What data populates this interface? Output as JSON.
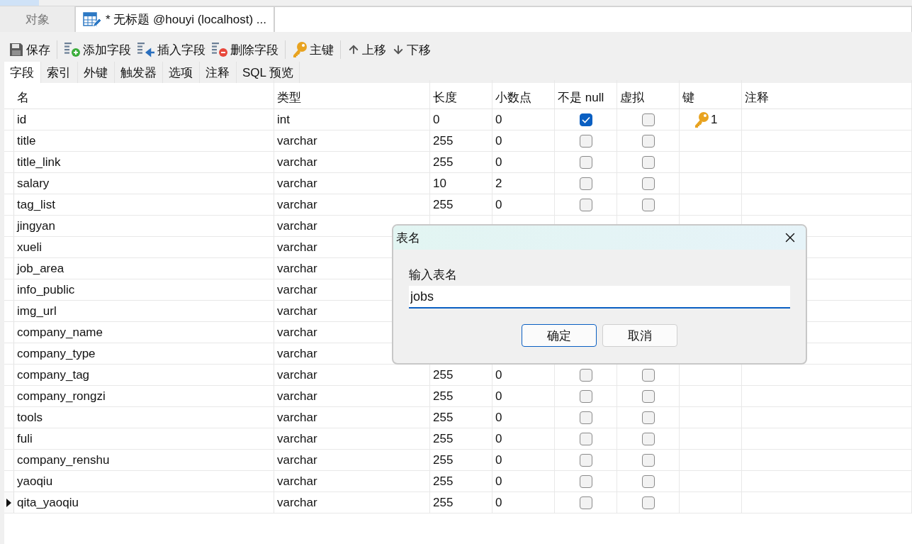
{
  "document_tabs": [
    {
      "label": "对象",
      "selected": false
    },
    {
      "label": "* 无标题 @houyi (localhost) ...",
      "selected": true
    }
  ],
  "toolbar": [
    {
      "kind": "save",
      "label": "保存"
    },
    {
      "kind": "add",
      "label": "添加字段"
    },
    {
      "kind": "insert",
      "label": "插入字段"
    },
    {
      "kind": "delete",
      "label": "删除字段"
    },
    {
      "kind": "key",
      "label": "主键"
    },
    {
      "kind": "up",
      "label": "上移"
    },
    {
      "kind": "down",
      "label": "下移"
    }
  ],
  "designer_tabs": [
    {
      "label": "字段",
      "selected": true
    },
    {
      "label": "索引",
      "selected": false
    },
    {
      "label": "外键",
      "selected": false
    },
    {
      "label": "触发器",
      "selected": false
    },
    {
      "label": "选项",
      "selected": false
    },
    {
      "label": "注释",
      "selected": false
    },
    {
      "label": "SQL 预览",
      "selected": false
    }
  ],
  "table": {
    "columns": [
      "名",
      "类型",
      "长度",
      "小数点",
      "不是 null",
      "虚拟",
      "键",
      "注释"
    ],
    "rows": [
      {
        "name": "id",
        "type": "int",
        "length": "0",
        "decimals": "0",
        "not_null": true,
        "virtual": false,
        "key": "1",
        "selected": false
      },
      {
        "name": "title",
        "type": "varchar",
        "length": "255",
        "decimals": "0",
        "not_null": false,
        "virtual": false,
        "selected": false
      },
      {
        "name": "title_link",
        "type": "varchar",
        "length": "255",
        "decimals": "0",
        "not_null": false,
        "virtual": false,
        "selected": false
      },
      {
        "name": "salary",
        "type": "varchar",
        "length": "10",
        "decimals": "2",
        "not_null": false,
        "virtual": false,
        "selected": false
      },
      {
        "name": "tag_list",
        "type": "varchar",
        "length": "255",
        "decimals": "0",
        "not_null": false,
        "virtual": false,
        "selected": false
      },
      {
        "name": "jingyan",
        "type": "varchar",
        "selected": false
      },
      {
        "name": "xueli",
        "type": "varchar",
        "selected": false
      },
      {
        "name": "job_area",
        "type": "varchar",
        "selected": false
      },
      {
        "name": "info_public",
        "type": "varchar",
        "selected": false
      },
      {
        "name": "img_url",
        "type": "varchar",
        "selected": false
      },
      {
        "name": "company_name",
        "type": "varchar",
        "selected": false
      },
      {
        "name": "company_type",
        "type": "varchar",
        "selected": false
      },
      {
        "name": "company_tag",
        "type": "varchar",
        "length": "255",
        "decimals": "0",
        "not_null": false,
        "virtual": false,
        "selected": false
      },
      {
        "name": "company_rongzi",
        "type": "varchar",
        "length": "255",
        "decimals": "0",
        "not_null": false,
        "virtual": false,
        "selected": false
      },
      {
        "name": "tools",
        "type": "varchar",
        "length": "255",
        "decimals": "0",
        "not_null": false,
        "virtual": false,
        "selected": false
      },
      {
        "name": "fuli",
        "type": "varchar",
        "length": "255",
        "decimals": "0",
        "not_null": false,
        "virtual": false,
        "selected": false
      },
      {
        "name": "company_renshu",
        "type": "varchar",
        "length": "255",
        "decimals": "0",
        "not_null": false,
        "virtual": false,
        "selected": false
      },
      {
        "name": "yaoqiu",
        "type": "varchar",
        "length": "255",
        "decimals": "0",
        "not_null": false,
        "virtual": false,
        "selected": false
      },
      {
        "name": "qita_yaoqiu",
        "type": "varchar",
        "length": "255",
        "decimals": "0",
        "not_null": false,
        "virtual": false,
        "selected": true
      }
    ]
  },
  "dialog": {
    "title": "表名",
    "label": "输入表名",
    "value": "jobs",
    "buttons": [
      {
        "label": "确定",
        "kind": "primary"
      },
      {
        "label": "取消",
        "kind": "secondary"
      }
    ]
  }
}
